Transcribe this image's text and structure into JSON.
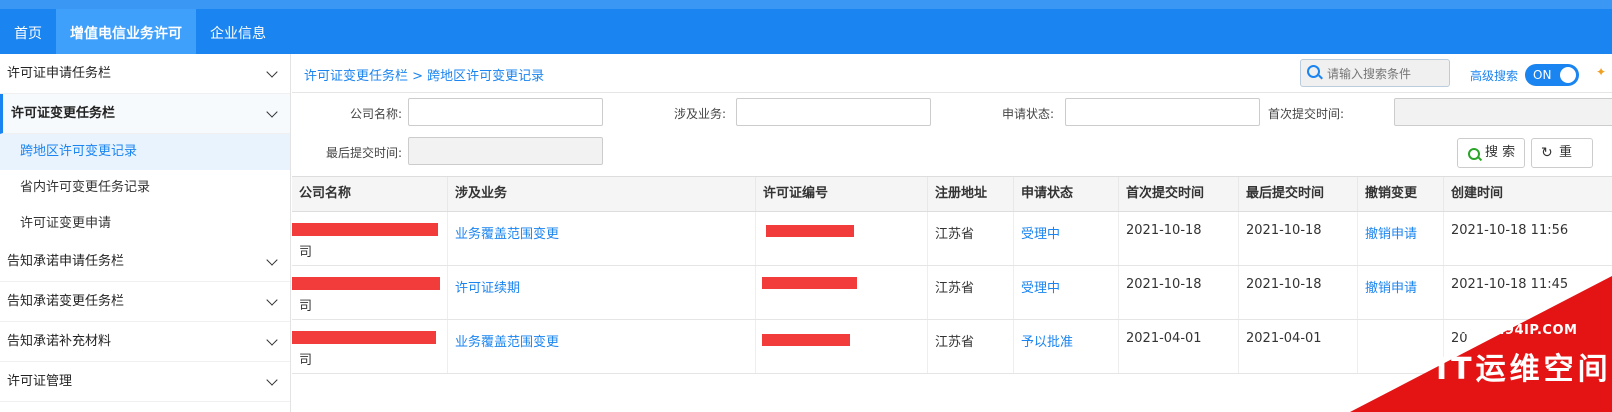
{
  "nav": {
    "items": [
      {
        "label": "首页",
        "active": false
      },
      {
        "label": "增值电信业务许可",
        "active": true
      },
      {
        "label": "企业信息",
        "active": false
      }
    ]
  },
  "sidebar": {
    "items": [
      {
        "label": "许可证申请任务栏"
      },
      {
        "label": "许可证变更任务栏",
        "open": true
      },
      {
        "label": "告知承诺申请任务栏"
      },
      {
        "label": "告知承诺变更任务栏"
      },
      {
        "label": "告知承诺补充材料"
      },
      {
        "label": "许可证管理"
      }
    ],
    "subitems": [
      {
        "label": "跨地区许可变更记录",
        "active": true
      },
      {
        "label": "省内许可变更任务记录"
      },
      {
        "label": "许可证变更申请"
      }
    ]
  },
  "breadcrumb": "许可证变更任务栏 > 跨地区许可变更记录",
  "search": {
    "placeholder": "请输入搜索条件"
  },
  "advanced": {
    "label": "高级搜索",
    "toggle": "ON"
  },
  "filters": {
    "company": "公司名称:",
    "business": "涉及业务:",
    "status": "申请状态:",
    "first_submit": "首次提交时间:",
    "last_submit": "最后提交时间:"
  },
  "buttons": {
    "search": "搜 索",
    "reset": "重"
  },
  "table": {
    "headers": [
      "公司名称",
      "涉及业务",
      "许可证编号",
      "注册地址",
      "申请状态",
      "首次提交时间",
      "最后提交时间",
      "撤销变更",
      "创建时间"
    ],
    "rows": [
      {
        "company_suffix": "司",
        "business": "业务覆盖范围变更",
        "address": "江苏省",
        "status": "受理中",
        "first": "2021-10-18",
        "last": "2021-10-18",
        "revoke": "撤销申请",
        "created": "2021-10-18 11:56"
      },
      {
        "company_suffix": "司",
        "business": "许可证续期",
        "address": "江苏省",
        "status": "受理中",
        "first": "2021-10-18",
        "last": "2021-10-18",
        "revoke": "撤销申请",
        "created": "2021-10-18 11:45"
      },
      {
        "company_suffix": "司",
        "business": "业务覆盖范围变更",
        "address": "江苏省",
        "status": "予以批准",
        "first": "2021-04-01",
        "last": "2021-04-01",
        "revoke": "",
        "created": "20"
      }
    ]
  },
  "watermark": {
    "url": "WWW.94IP.COM",
    "text": "IT运维空间"
  },
  "colors": {
    "primary": "#1a84f0",
    "redact": "#f23c3c",
    "watermark": "#e51414"
  }
}
